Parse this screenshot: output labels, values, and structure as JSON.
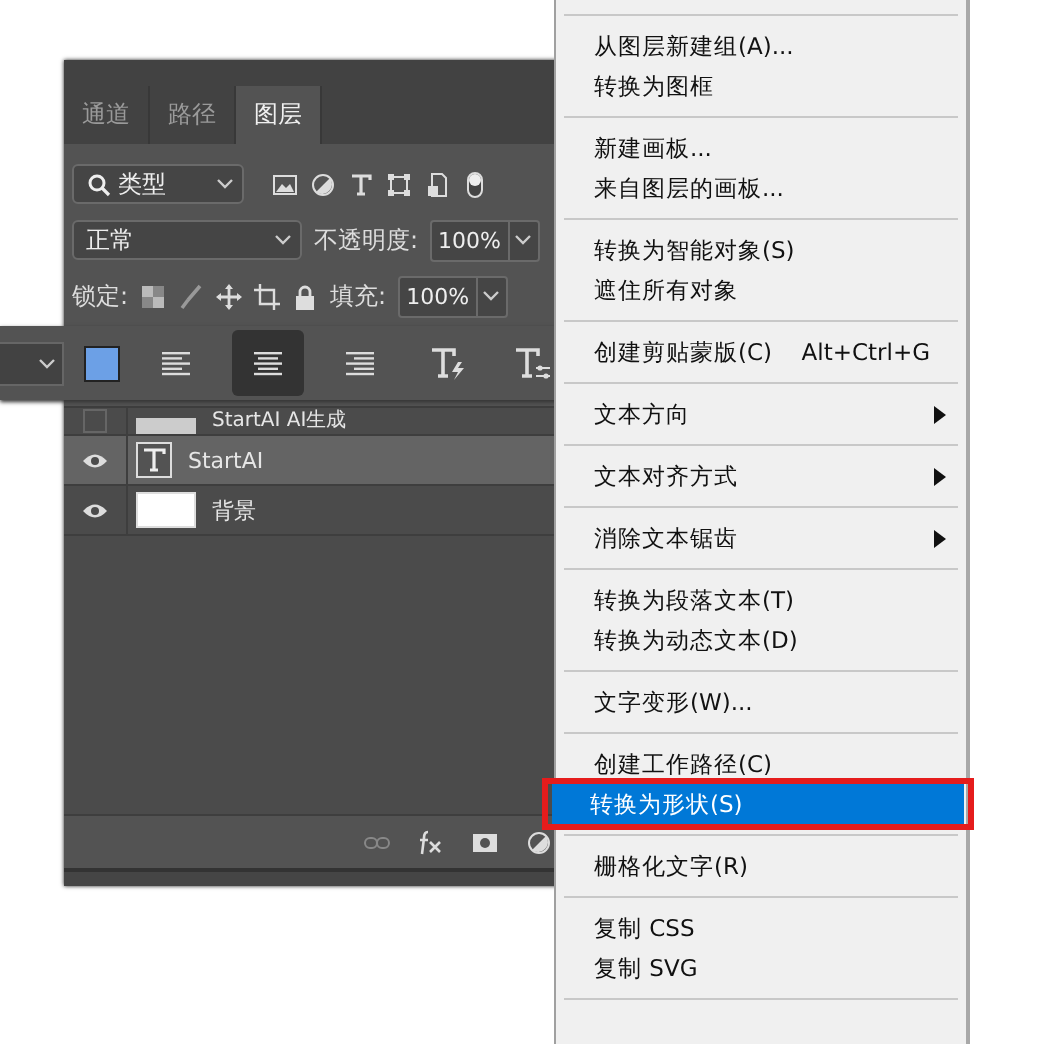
{
  "panel": {
    "tabs": [
      {
        "label": "通道",
        "selected": false
      },
      {
        "label": "路径",
        "selected": false
      },
      {
        "label": "图层",
        "selected": true
      }
    ],
    "filter": {
      "value": "类型"
    },
    "blend_mode": {
      "value": "正常"
    },
    "opacity": {
      "label": "不透明度:",
      "value": "100%"
    },
    "lock": {
      "label": "锁定:"
    },
    "fill": {
      "label": "填充:",
      "value": "100%"
    },
    "layers": [
      {
        "name": "StartAI AI生成",
        "visible": false,
        "kind": "smart",
        "selected": false
      },
      {
        "name": "StartAI",
        "visible": true,
        "kind": "text",
        "selected": true
      },
      {
        "name": "背景",
        "visible": true,
        "kind": "fill",
        "selected": false
      }
    ]
  },
  "text_toolbar": {
    "align": [
      {
        "kind": "left",
        "selected": false
      },
      {
        "kind": "center",
        "selected": true
      },
      {
        "kind": "right",
        "selected": false
      }
    ]
  },
  "menu": {
    "groups": [
      [
        {
          "label": "从图层新建组(A)...",
          "selected": false,
          "submenu": false
        },
        {
          "label": "转换为图框",
          "selected": false,
          "submenu": false
        }
      ],
      [
        {
          "label": "新建画板...",
          "selected": false,
          "submenu": false
        },
        {
          "label": "来自图层的画板...",
          "selected": false,
          "submenu": false
        }
      ],
      [
        {
          "label": "转换为智能对象(S)",
          "selected": false,
          "submenu": false
        },
        {
          "label": "遮住所有对象",
          "selected": false,
          "submenu": false
        }
      ],
      [
        {
          "label": "创建剪贴蒙版(C)",
          "shortcut": "Alt+Ctrl+G",
          "selected": false,
          "submenu": false
        }
      ],
      [
        {
          "label": "文本方向",
          "selected": false,
          "submenu": true
        }
      ],
      [
        {
          "label": "文本对齐方式",
          "selected": false,
          "submenu": true
        }
      ],
      [
        {
          "label": "消除文本锯齿",
          "selected": false,
          "submenu": true
        }
      ],
      [
        {
          "label": "转换为段落文本(T)",
          "selected": false,
          "submenu": false
        },
        {
          "label": "转换为动态文本(D)",
          "selected": false,
          "submenu": false
        }
      ],
      [
        {
          "label": "文字变形(W)...",
          "selected": false,
          "submenu": false
        }
      ],
      [
        {
          "label": "创建工作路径(C)",
          "selected": false,
          "submenu": false
        },
        {
          "label": "转换为形状(S)",
          "selected": true,
          "submenu": false
        }
      ],
      [
        {
          "label": "栅格化文字(R)",
          "selected": false,
          "submenu": false
        }
      ],
      [
        {
          "label": "复制 CSS",
          "selected": false,
          "submenu": false
        },
        {
          "label": "复制 SVG",
          "selected": false,
          "submenu": false
        }
      ]
    ]
  }
}
